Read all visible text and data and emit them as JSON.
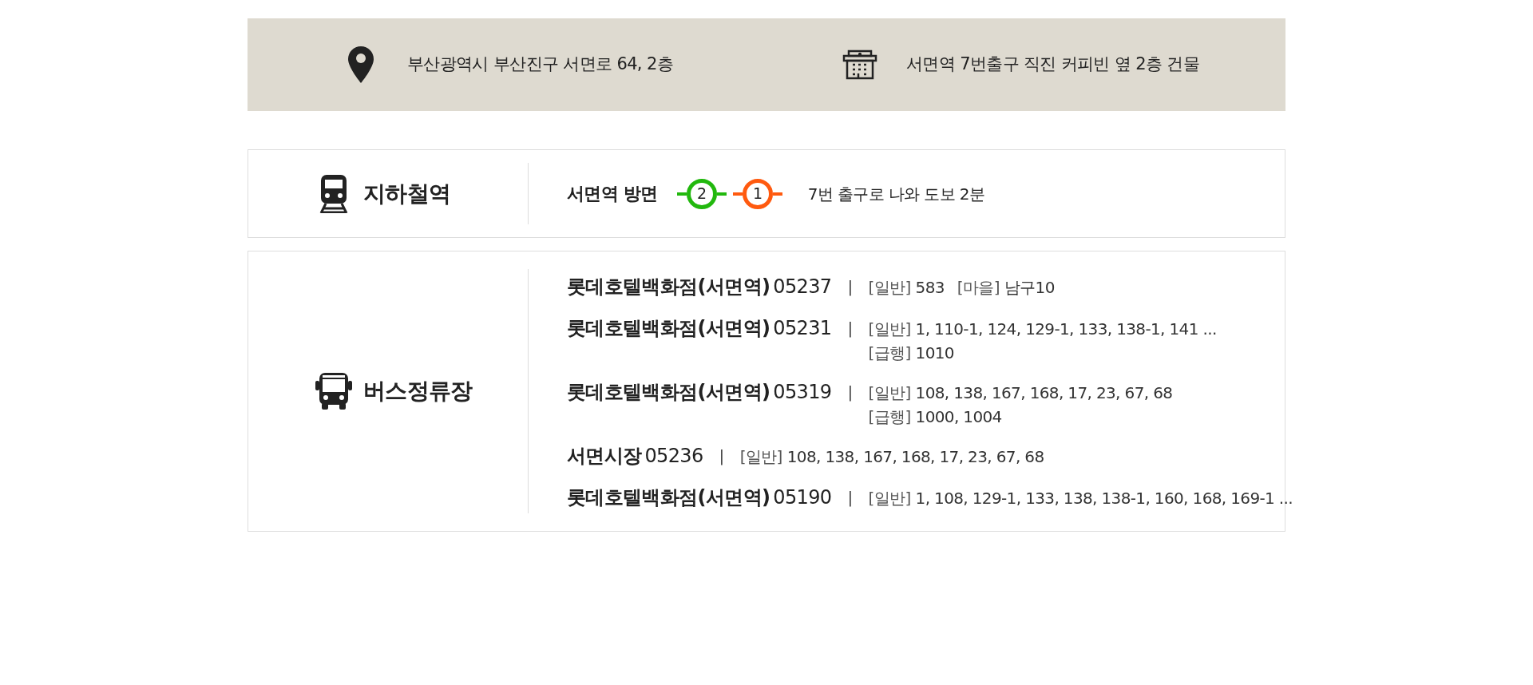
{
  "info_bar": {
    "address": "부산광역시 부산진구 서면로 64, 2층",
    "directions": "서면역 7번출구 직진 커피빈 옆 2층 건물"
  },
  "subway": {
    "title": "지하철역",
    "station": "서면역 방면",
    "lines": [
      {
        "number": "2",
        "color": "#22b80e"
      },
      {
        "number": "1",
        "color": "#ff5a0f"
      }
    ],
    "note": "7번 출구로 나와 도보 2분"
  },
  "bus": {
    "title": "버스정류장",
    "stops": [
      {
        "name": "롯데호텔백화점(서면역)",
        "code": "05237",
        "separator": "|",
        "lines": [
          {
            "groups": [
              {
                "label": "[일반]",
                "routes": "583"
              },
              {
                "label": "[마을]",
                "routes": "남구10"
              }
            ]
          }
        ]
      },
      {
        "name": "롯데호텔백화점(서면역)",
        "code": "05231",
        "separator": "|",
        "lines": [
          {
            "groups": [
              {
                "label": "[일반]",
                "routes": "1, 110-1, 124, 129-1, 133, 138-1, 141 ..."
              }
            ]
          },
          {
            "groups": [
              {
                "label": "[급행]",
                "routes": "1010"
              }
            ]
          }
        ]
      },
      {
        "name": "롯데호텔백화점(서면역)",
        "code": "05319",
        "separator": "|",
        "lines": [
          {
            "groups": [
              {
                "label": "[일반]",
                "routes": "108, 138, 167, 168, 17, 23, 67, 68"
              }
            ]
          },
          {
            "groups": [
              {
                "label": "[급행]",
                "routes": "1000, 1004"
              }
            ]
          }
        ]
      },
      {
        "name": "서면시장",
        "code": "05236",
        "separator": "|",
        "lines": [
          {
            "groups": [
              {
                "label": "[일반]",
                "routes": "108, 138, 167, 168, 17, 23, 67, 68"
              }
            ]
          }
        ]
      },
      {
        "name": "롯데호텔백화점(서면역)",
        "code": "05190",
        "separator": "|",
        "lines": [
          {
            "groups": [
              {
                "label": "[일반]",
                "routes": "1, 108, 129-1, 133, 138, 138-1, 160, 168, 169-1 ..."
              }
            ]
          }
        ]
      }
    ]
  }
}
